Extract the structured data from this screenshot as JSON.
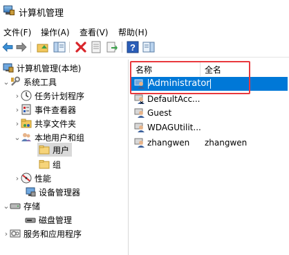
{
  "window": {
    "title": "计算机管理"
  },
  "menu": [
    {
      "label": "文件(F)"
    },
    {
      "label": "操作(A)"
    },
    {
      "label": "查看(V)"
    },
    {
      "label": "帮助(H)"
    }
  ],
  "tree": {
    "root": "计算机管理(本地)",
    "system_tools": "系统工具",
    "task_scheduler": "任务计划程序",
    "event_viewer": "事件查看器",
    "shared_folders": "共享文件夹",
    "local_users_groups": "本地用户和组",
    "users": "用户",
    "groups": "组",
    "performance": "性能",
    "device_manager": "设备管理器",
    "storage": "存储",
    "disk_management": "磁盘管理",
    "services_apps": "服务和应用程序"
  },
  "list": {
    "columns": {
      "name": "名称",
      "fullname": "全名"
    },
    "rows": [
      {
        "name": "Administrator",
        "fullname": ""
      },
      {
        "name": "DefaultAcc...",
        "fullname": ""
      },
      {
        "name": "Guest",
        "fullname": ""
      },
      {
        "name": "WDAGUtilit...",
        "fullname": ""
      },
      {
        "name": "zhangwen",
        "fullname": "zhangwen"
      }
    ]
  },
  "colors": {
    "selection": "#0078d7",
    "highlight_box": "#e8383d",
    "tree_selected": "#d9d9d9"
  },
  "icons": [
    "back-icon",
    "forward-icon",
    "up-folder-icon",
    "show-hide-tree-icon",
    "delete-icon",
    "properties-icon",
    "export-icon",
    "help-icon",
    "show-action-pane-icon"
  ]
}
